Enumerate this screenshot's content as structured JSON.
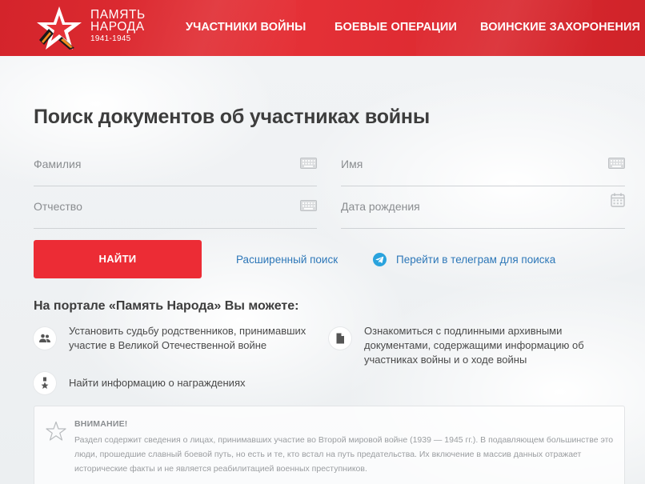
{
  "header": {
    "logo": {
      "line1": "ПАМЯТЬ",
      "line2": "НАРОДА",
      "years": "1941-1945"
    },
    "nav": [
      {
        "label": "УЧАСТНИКИ ВОЙНЫ"
      },
      {
        "label": "БОЕВЫЕ ОПЕРАЦИИ"
      },
      {
        "label": "ВОИНСКИЕ ЗАХОРОНЕНИЯ"
      }
    ]
  },
  "search": {
    "title": "Поиск документов об участниках войны",
    "fields": {
      "surname": {
        "placeholder": "Фамилия",
        "icon": "keyboard-icon"
      },
      "name": {
        "placeholder": "Имя",
        "icon": "keyboard-icon"
      },
      "patronymic": {
        "placeholder": "Отчество",
        "icon": "keyboard-icon"
      },
      "birthdate": {
        "placeholder": "Дата рождения",
        "icon": "calendar-icon"
      }
    },
    "find_button": "НАЙТИ",
    "advanced_link": "Расширенный поиск",
    "telegram_link": "Перейти в телеграм для поиска"
  },
  "features": {
    "title": "На портале «Память Народа» Вы можете:",
    "items": [
      {
        "text": "Установить судьбу родственников, принимавших участие в Великой Отечественной войне",
        "icon": "people-icon"
      },
      {
        "text": "Ознакомиться с подлинными архивными документами, содержащими информацию об участниках войны и о ходе войны",
        "icon": "document-icon"
      },
      {
        "text": "Найти информацию о награждениях",
        "icon": "medal-icon"
      }
    ]
  },
  "notice": {
    "title": "ВНИМАНИЕ!",
    "text": "Раздел содержит сведения о лицах, принимавших участие во Второй мировой войне (1939 — 1945 гг.). В подавляющем большинстве это люди, прошедшие славный боевой путь, но есть и те, кто встал на путь предательства. Их включение в массив данных отражает исторические факты и не является реабилитацией военных преступников."
  },
  "colors": {
    "header_red": "#e53137",
    "button_red": "#ec2c35",
    "link_blue": "#2d77b8",
    "text_dark": "#3d3d3d"
  }
}
